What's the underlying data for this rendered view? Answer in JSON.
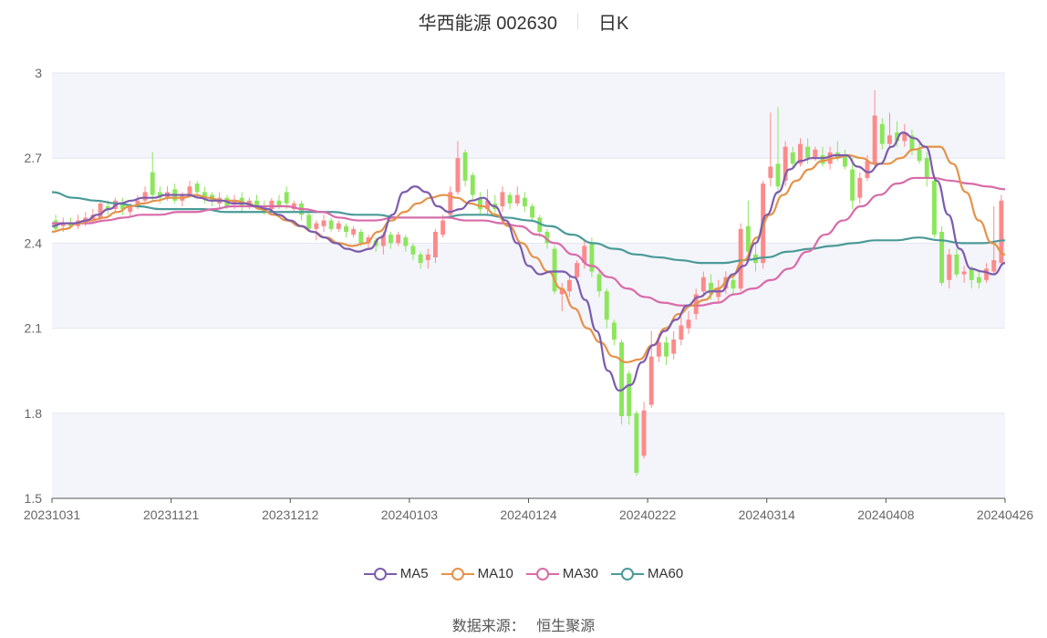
{
  "header": {
    "title": "华西能源 002630",
    "period": "日K"
  },
  "footer": {
    "source_label": "数据来源：",
    "source_name": "恒生聚源"
  },
  "colors": {
    "up": "#fd8a8a",
    "down": "#8ce65c",
    "MA5": "#7c5cad",
    "MA10": "#e5924a",
    "MA30": "#d96aa9",
    "MA60": "#4a9a98"
  },
  "chart_data": {
    "type": "candlestick",
    "y_ticks": [
      "1.5",
      "1.8",
      "2.1",
      "2.4",
      "2.7",
      "3"
    ],
    "ylim": [
      1.5,
      3.0
    ],
    "x_ticks": [
      "20231031",
      "20231121",
      "20231212",
      "20240103",
      "20240124",
      "20240222",
      "20240314",
      "20240408",
      "20240426"
    ],
    "legend": [
      "MA5",
      "MA10",
      "MA30",
      "MA60"
    ],
    "candles": [
      [
        2.48,
        2.45,
        2.5,
        2.44
      ],
      [
        2.46,
        2.47,
        2.49,
        2.44
      ],
      [
        2.47,
        2.46,
        2.49,
        2.45
      ],
      [
        2.46,
        2.48,
        2.5,
        2.45
      ],
      [
        2.48,
        2.49,
        2.51,
        2.46
      ],
      [
        2.48,
        2.5,
        2.52,
        2.47
      ],
      [
        2.49,
        2.54,
        2.55,
        2.48
      ],
      [
        2.53,
        2.52,
        2.55,
        2.5
      ],
      [
        2.52,
        2.55,
        2.56,
        2.51
      ],
      [
        2.54,
        2.52,
        2.56,
        2.5
      ],
      [
        2.51,
        2.53,
        2.54,
        2.49
      ],
      [
        2.53,
        2.55,
        2.57,
        2.52
      ],
      [
        2.55,
        2.58,
        2.6,
        2.54
      ],
      [
        2.65,
        2.57,
        2.72,
        2.55
      ],
      [
        2.58,
        2.56,
        2.6,
        2.54
      ],
      [
        2.56,
        2.58,
        2.6,
        2.55
      ],
      [
        2.59,
        2.55,
        2.61,
        2.54
      ],
      [
        2.55,
        2.57,
        2.58,
        2.53
      ],
      [
        2.57,
        2.6,
        2.62,
        2.56
      ],
      [
        2.61,
        2.58,
        2.62,
        2.56
      ],
      [
        2.58,
        2.56,
        2.6,
        2.54
      ],
      [
        2.57,
        2.55,
        2.58,
        2.53
      ],
      [
        2.54,
        2.56,
        2.58,
        2.52
      ],
      [
        2.56,
        2.53,
        2.57,
        2.52
      ],
      [
        2.54,
        2.55,
        2.57,
        2.52
      ],
      [
        2.56,
        2.53,
        2.58,
        2.51
      ],
      [
        2.53,
        2.55,
        2.56,
        2.52
      ],
      [
        2.55,
        2.53,
        2.57,
        2.52
      ],
      [
        2.53,
        2.51,
        2.55,
        2.5
      ],
      [
        2.52,
        2.55,
        2.56,
        2.51
      ],
      [
        2.55,
        2.53,
        2.57,
        2.52
      ],
      [
        2.58,
        2.54,
        2.6,
        2.52
      ],
      [
        2.52,
        2.54,
        2.55,
        2.51
      ],
      [
        2.54,
        2.5,
        2.55,
        2.48
      ],
      [
        2.5,
        2.45,
        2.51,
        2.44
      ],
      [
        2.45,
        2.47,
        2.48,
        2.41
      ],
      [
        2.46,
        2.48,
        2.5,
        2.44
      ],
      [
        2.48,
        2.45,
        2.49,
        2.44
      ],
      [
        2.45,
        2.47,
        2.48,
        2.44
      ],
      [
        2.46,
        2.44,
        2.47,
        2.42
      ],
      [
        2.43,
        2.45,
        2.46,
        2.42
      ],
      [
        2.44,
        2.4,
        2.45,
        2.39
      ],
      [
        2.4,
        2.42,
        2.43,
        2.38
      ],
      [
        2.41,
        2.39,
        2.42,
        2.37
      ],
      [
        2.39,
        2.43,
        2.44,
        2.36
      ],
      [
        2.43,
        2.4,
        2.44,
        2.38
      ],
      [
        2.4,
        2.43,
        2.44,
        2.39
      ],
      [
        2.42,
        2.39,
        2.43,
        2.37
      ],
      [
        2.39,
        2.36,
        2.4,
        2.34
      ],
      [
        2.36,
        2.33,
        2.37,
        2.31
      ],
      [
        2.34,
        2.36,
        2.38,
        2.31
      ],
      [
        2.35,
        2.44,
        2.45,
        2.33
      ],
      [
        2.43,
        2.48,
        2.5,
        2.42
      ],
      [
        2.5,
        2.58,
        2.6,
        2.49
      ],
      [
        2.58,
        2.7,
        2.76,
        2.57
      ],
      [
        2.72,
        2.62,
        2.73,
        2.6
      ],
      [
        2.64,
        2.57,
        2.65,
        2.55
      ],
      [
        2.56,
        2.52,
        2.58,
        2.5
      ],
      [
        2.52,
        2.55,
        2.59,
        2.5
      ],
      [
        2.54,
        2.52,
        2.57,
        2.5
      ],
      [
        2.53,
        2.58,
        2.6,
        2.51
      ],
      [
        2.57,
        2.54,
        2.58,
        2.52
      ],
      [
        2.54,
        2.57,
        2.6,
        2.53
      ],
      [
        2.56,
        2.53,
        2.58,
        2.51
      ],
      [
        2.53,
        2.49,
        2.54,
        2.48
      ],
      [
        2.49,
        2.44,
        2.5,
        2.42
      ],
      [
        2.44,
        2.4,
        2.45,
        2.38
      ],
      [
        2.38,
        2.23,
        2.39,
        2.22
      ],
      [
        2.22,
        2.24,
        2.26,
        2.16
      ],
      [
        2.23,
        2.27,
        2.29,
        2.21
      ],
      [
        2.28,
        2.33,
        2.34,
        2.26
      ],
      [
        2.33,
        2.39,
        2.41,
        2.31
      ],
      [
        2.4,
        2.3,
        2.42,
        2.28
      ],
      [
        2.29,
        2.23,
        2.31,
        2.21
      ],
      [
        2.23,
        2.13,
        2.24,
        2.1
      ],
      [
        2.12,
        2.06,
        2.13,
        2.04
      ],
      [
        2.05,
        1.79,
        2.06,
        1.76
      ],
      [
        1.94,
        1.79,
        1.95,
        1.76
      ],
      [
        1.8,
        1.59,
        1.81,
        1.58
      ],
      [
        1.65,
        1.81,
        1.84,
        1.64
      ],
      [
        1.83,
        2.0,
        2.09,
        1.82
      ],
      [
        2.0,
        2.05,
        2.08,
        1.98
      ],
      [
        2.05,
        2.0,
        2.07,
        1.97
      ],
      [
        2.01,
        2.06,
        2.09,
        1.99
      ],
      [
        2.06,
        2.11,
        2.14,
        2.04
      ],
      [
        2.1,
        2.13,
        2.16,
        2.08
      ],
      [
        2.15,
        2.22,
        2.24,
        2.13
      ],
      [
        2.23,
        2.28,
        2.3,
        2.21
      ],
      [
        2.26,
        2.22,
        2.29,
        2.2
      ],
      [
        2.21,
        2.24,
        2.27,
        2.19
      ],
      [
        2.24,
        2.28,
        2.3,
        2.22
      ],
      [
        2.27,
        2.24,
        2.29,
        2.22
      ],
      [
        2.24,
        2.45,
        2.47,
        2.23
      ],
      [
        2.46,
        2.37,
        2.55,
        2.35
      ],
      [
        2.36,
        2.33,
        2.4,
        2.3
      ],
      [
        2.33,
        2.61,
        2.62,
        2.31
      ],
      [
        2.63,
        2.67,
        2.86,
        2.6
      ],
      [
        2.68,
        2.6,
        2.88,
        2.57
      ],
      [
        2.62,
        2.74,
        2.76,
        2.6
      ],
      [
        2.72,
        2.68,
        2.74,
        2.66
      ],
      [
        2.68,
        2.75,
        2.77,
        2.67
      ],
      [
        2.74,
        2.7,
        2.77,
        2.68
      ],
      [
        2.7,
        2.73,
        2.74,
        2.69
      ],
      [
        2.71,
        2.68,
        2.74,
        2.67
      ],
      [
        2.68,
        2.72,
        2.74,
        2.66
      ],
      [
        2.72,
        2.7,
        2.76,
        2.69
      ],
      [
        2.71,
        2.67,
        2.73,
        2.66
      ],
      [
        2.66,
        2.55,
        2.7,
        2.52
      ],
      [
        2.56,
        2.63,
        2.65,
        2.54
      ],
      [
        2.63,
        2.69,
        2.71,
        2.62
      ],
      [
        2.68,
        2.85,
        2.94,
        2.67
      ],
      [
        2.82,
        2.75,
        2.84,
        2.73
      ],
      [
        2.75,
        2.78,
        2.86,
        2.74
      ],
      [
        2.79,
        2.76,
        2.83,
        2.74
      ],
      [
        2.76,
        2.79,
        2.82,
        2.74
      ],
      [
        2.78,
        2.73,
        2.8,
        2.71
      ],
      [
        2.73,
        2.69,
        2.75,
        2.68
      ],
      [
        2.7,
        2.63,
        2.72,
        2.6
      ],
      [
        2.62,
        2.43,
        2.64,
        2.42
      ],
      [
        2.44,
        2.26,
        2.46,
        2.25
      ],
      [
        2.27,
        2.36,
        2.38,
        2.24
      ],
      [
        2.36,
        2.29,
        2.38,
        2.28
      ],
      [
        2.29,
        2.3,
        2.32,
        2.26
      ],
      [
        2.31,
        2.27,
        2.32,
        2.24
      ],
      [
        2.28,
        2.26,
        2.3,
        2.24
      ],
      [
        2.27,
        2.31,
        2.33,
        2.26
      ],
      [
        2.3,
        2.34,
        2.53,
        2.29
      ],
      [
        2.33,
        2.55,
        2.57,
        2.32
      ]
    ],
    "ma5": [
      2.46,
      2.47,
      2.47,
      2.48,
      2.5,
      2.52,
      2.54,
      2.55,
      2.56,
      2.56,
      2.57,
      2.57,
      2.57,
      2.56,
      2.55,
      2.55,
      2.54,
      2.54,
      2.53,
      2.52,
      2.5,
      2.48,
      2.46,
      2.44,
      2.42,
      2.4,
      2.38,
      2.37,
      2.38,
      2.42,
      2.5,
      2.58,
      2.6,
      2.58,
      2.53,
      2.51,
      2.52,
      2.55,
      2.56,
      2.53,
      2.48,
      2.4,
      2.32,
      2.29,
      2.3,
      2.3,
      2.28,
      2.2,
      2.09,
      1.95,
      1.88,
      1.9,
      1.98,
      2.04,
      2.09,
      2.13,
      2.18,
      2.21,
      2.23,
      2.23,
      2.29,
      2.32,
      2.4,
      2.5,
      2.58,
      2.66,
      2.69,
      2.7,
      2.7,
      2.71,
      2.71,
      2.67,
      2.65,
      2.68,
      2.74,
      2.79,
      2.77,
      2.74,
      2.62,
      2.5,
      2.38,
      2.31,
      2.3,
      2.29,
      2.33
    ],
    "ma10": [
      2.44,
      2.45,
      2.47,
      2.48,
      2.49,
      2.51,
      2.53,
      2.54,
      2.55,
      2.56,
      2.56,
      2.57,
      2.56,
      2.55,
      2.55,
      2.54,
      2.52,
      2.5,
      2.48,
      2.46,
      2.44,
      2.42,
      2.4,
      2.39,
      2.4,
      2.44,
      2.48,
      2.51,
      2.54,
      2.56,
      2.57,
      2.56,
      2.54,
      2.53,
      2.5,
      2.46,
      2.4,
      2.35,
      2.3,
      2.24,
      2.17,
      2.1,
      2.05,
      2.0,
      1.98,
      1.99,
      2.04,
      2.1,
      2.15,
      2.18,
      2.2,
      2.24,
      2.28,
      2.34,
      2.42,
      2.5,
      2.57,
      2.62,
      2.66,
      2.69,
      2.7,
      2.71,
      2.7,
      2.68,
      2.68,
      2.7,
      2.73,
      2.74,
      2.74,
      2.68,
      2.58,
      2.48,
      2.4,
      2.36
    ],
    "ma30": [
      2.47,
      2.47,
      2.47,
      2.48,
      2.49,
      2.5,
      2.5,
      2.51,
      2.51,
      2.52,
      2.53,
      2.53,
      2.53,
      2.53,
      2.52,
      2.51,
      2.49,
      2.48,
      2.48,
      2.49,
      2.49,
      2.49,
      2.49,
      2.48,
      2.48,
      2.47,
      2.46,
      2.43,
      2.4,
      2.36,
      2.32,
      2.28,
      2.24,
      2.21,
      2.19,
      2.18,
      2.18,
      2.19,
      2.22,
      2.24,
      2.27,
      2.31,
      2.37,
      2.43,
      2.48,
      2.53,
      2.57,
      2.61,
      2.63,
      2.63,
      2.62,
      2.61,
      2.6,
      2.59
    ],
    "ma60": [
      2.58,
      2.56,
      2.55,
      2.54,
      2.53,
      2.52,
      2.52,
      2.52,
      2.51,
      2.51,
      2.51,
      2.51,
      2.51,
      2.51,
      2.5,
      2.5,
      2.49,
      2.49,
      2.49,
      2.5,
      2.5,
      2.49,
      2.48,
      2.46,
      2.43,
      2.4,
      2.38,
      2.36,
      2.35,
      2.34,
      2.33,
      2.33,
      2.34,
      2.35,
      2.37,
      2.38,
      2.39,
      2.4,
      2.41,
      2.41,
      2.42,
      2.41,
      2.4,
      2.4,
      2.41
    ]
  }
}
